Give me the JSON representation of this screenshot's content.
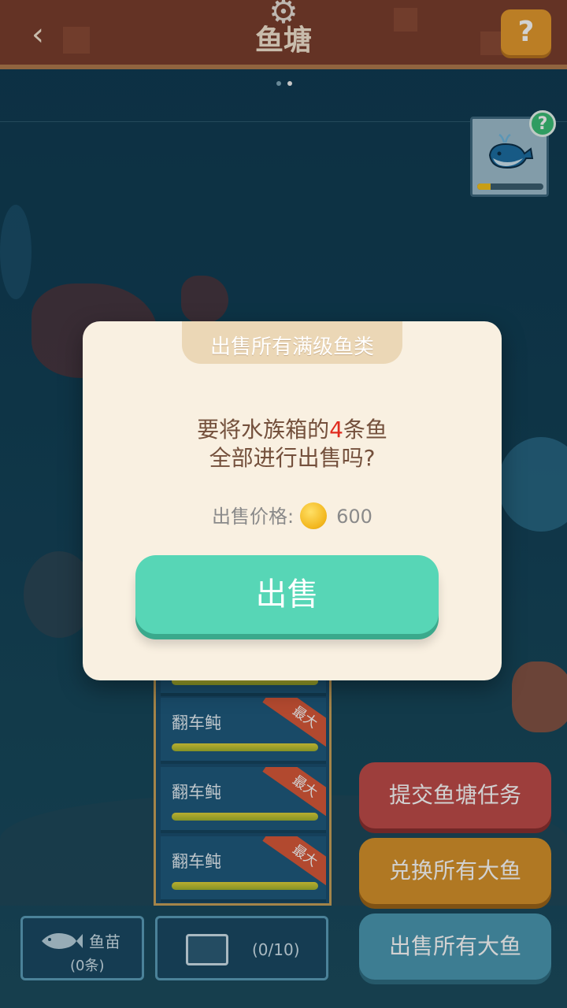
{
  "header": {
    "title": "鱼塘",
    "back_icon": "back-arrow-icon",
    "settings_icon": "gear-icon",
    "help_label": "?"
  },
  "pager": {
    "pages": 2,
    "active_index": 1
  },
  "whale_card": {
    "help_label": "?",
    "progress": 0.2,
    "icon": "whale-icon"
  },
  "fish_list": {
    "items": [
      {
        "name": "翻车鲀",
        "badge": "最大"
      },
      {
        "name": "翻车鲀",
        "badge": "最大"
      },
      {
        "name": "翻车鲀",
        "badge": "最大"
      }
    ]
  },
  "actions": {
    "submit_task": "提交鱼塘任务",
    "exchange_big": "兑换所有大鱼",
    "sell_big": "出售所有大鱼"
  },
  "bottom": {
    "fry_label": "鱼苗",
    "fry_count": "(0条)",
    "tank_count": "(0/10)"
  },
  "dialog": {
    "title": "出售所有满级鱼类",
    "msg_prefix": "要将水族箱的",
    "msg_count": "4",
    "msg_suffix": "条鱼",
    "msg_line2": "全部进行出售吗?",
    "price_label": "出售价格:",
    "price_value": "600",
    "sell_button": "出售"
  },
  "colors": {
    "accent_green": "#57d6b6",
    "task_red": "#c04c4a",
    "exchange_orange": "#d7932b",
    "sell_blue": "#4b99b3",
    "highlight_red": "#e02b1f"
  }
}
